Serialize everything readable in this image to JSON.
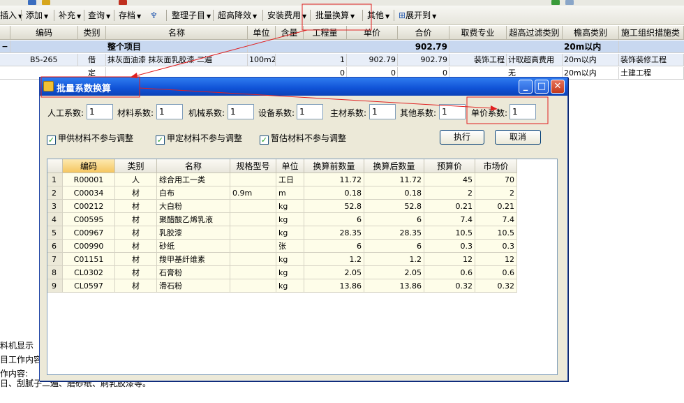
{
  "toolbar": {
    "items": [
      {
        "label": "插入",
        "icon": "insert"
      },
      {
        "label": "添加",
        "icon": "add"
      },
      {
        "label": "补充",
        "icon": "supplement"
      },
      {
        "label": "查询",
        "icon": "query"
      },
      {
        "label": "存档",
        "icon": "archive"
      },
      {
        "label": "整理子目",
        "icon": "organize"
      },
      {
        "label": "超高降效",
        "icon": "height"
      },
      {
        "label": "安装费用",
        "icon": "install"
      },
      {
        "label": "批量换算",
        "icon": "batch"
      },
      {
        "label": "其他",
        "icon": "other"
      },
      {
        "label": "展开到",
        "icon": "expand"
      }
    ]
  },
  "grid": {
    "headers": [
      "编码",
      "类别",
      "名称",
      "单位",
      "含量",
      "工程量",
      "单价",
      "合价",
      "取费专业",
      "超高过滤类别",
      "檐高类别",
      "施工组织措施类别"
    ],
    "row_group": {
      "name": "整个项目",
      "total": "902.79",
      "eave": "20m以内"
    },
    "row_item": {
      "code": "B5-265",
      "type": "借",
      "name": "抹灰面油漆 抹灰面乳胶漆 二遍",
      "unit": "100m2",
      "qty": "1",
      "price": "902.79",
      "total": "902.79",
      "fee": "装饰工程",
      "filter": "计取超高费用",
      "eave": "20m以内",
      "measure": "装饰装修工程"
    },
    "row_third": {
      "type": "定",
      "qty": "0",
      "price": "0",
      "total": "0",
      "filter": "无",
      "eave": "20m以内",
      "measure": "土建工程"
    }
  },
  "left_panel": {
    "line1": "料机显示",
    "line2": "目工作内容",
    "line3": "作内容:"
  },
  "bottom_text": "日、刮腻子二遍、磨砂纸、刷乳胶漆等。",
  "dialog": {
    "title": "批量系数换算",
    "coefficients": [
      {
        "label": "人工系数:",
        "value": "1"
      },
      {
        "label": "材料系数:",
        "value": "1"
      },
      {
        "label": "机械系数:",
        "value": "1"
      },
      {
        "label": "设备系数:",
        "value": "1"
      },
      {
        "label": "主材系数:",
        "value": "1"
      },
      {
        "label": "其他系数:",
        "value": "1"
      },
      {
        "label": "单价系数:",
        "value": "1"
      }
    ],
    "checkboxes": [
      {
        "label": "甲供材料不参与调整",
        "checked": true
      },
      {
        "label": "甲定材料不参与调整",
        "checked": true
      },
      {
        "label": "暂估材料不参与调整",
        "checked": true
      }
    ],
    "execute_label": "执行",
    "cancel_label": "取消",
    "table": {
      "headers": [
        "编码",
        "类别",
        "名称",
        "规格型号",
        "单位",
        "换算前数量",
        "换算后数量",
        "预算价",
        "市场价"
      ],
      "rows": [
        {
          "no": "1",
          "code": "R00001",
          "type": "人",
          "name": "综合用工一类",
          "spec": "",
          "unit": "工日",
          "before": "11.72",
          "after": "11.72",
          "budget": "45",
          "market": "70"
        },
        {
          "no": "2",
          "code": "C00034",
          "type": "材",
          "name": "白布",
          "spec": "0.9m",
          "unit": "m",
          "before": "0.18",
          "after": "0.18",
          "budget": "2",
          "market": "2"
        },
        {
          "no": "3",
          "code": "C00212",
          "type": "材",
          "name": "大白粉",
          "spec": "",
          "unit": "kg",
          "before": "52.8",
          "after": "52.8",
          "budget": "0.21",
          "market": "0.21"
        },
        {
          "no": "4",
          "code": "C00595",
          "type": "材",
          "name": "聚醋酸乙烯乳液",
          "spec": "",
          "unit": "kg",
          "before": "6",
          "after": "6",
          "budget": "7.4",
          "market": "7.4"
        },
        {
          "no": "5",
          "code": "C00967",
          "type": "材",
          "name": "乳胶漆",
          "spec": "",
          "unit": "kg",
          "before": "28.35",
          "after": "28.35",
          "budget": "10.5",
          "market": "10.5"
        },
        {
          "no": "6",
          "code": "C00990",
          "type": "材",
          "name": "砂纸",
          "spec": "",
          "unit": "张",
          "before": "6",
          "after": "6",
          "budget": "0.3",
          "market": "0.3"
        },
        {
          "no": "7",
          "code": "C01151",
          "type": "材",
          "name": "羧甲基纤维素",
          "spec": "",
          "unit": "kg",
          "before": "1.2",
          "after": "1.2",
          "budget": "12",
          "market": "12"
        },
        {
          "no": "8",
          "code": "CL0302",
          "type": "材",
          "name": "石膏粉",
          "spec": "",
          "unit": "kg",
          "before": "2.05",
          "after": "2.05",
          "budget": "0.6",
          "market": "0.6"
        },
        {
          "no": "9",
          "code": "CL0597",
          "type": "材",
          "name": "滑石粉",
          "spec": "",
          "unit": "kg",
          "before": "13.86",
          "after": "13.86",
          "budget": "0.32",
          "market": "0.32"
        }
      ]
    }
  },
  "colors": {
    "title_bar": "#1052d6",
    "annotation": "#e02020",
    "group_row": "#c8d8f0",
    "cell_bg": "#fefde9"
  }
}
